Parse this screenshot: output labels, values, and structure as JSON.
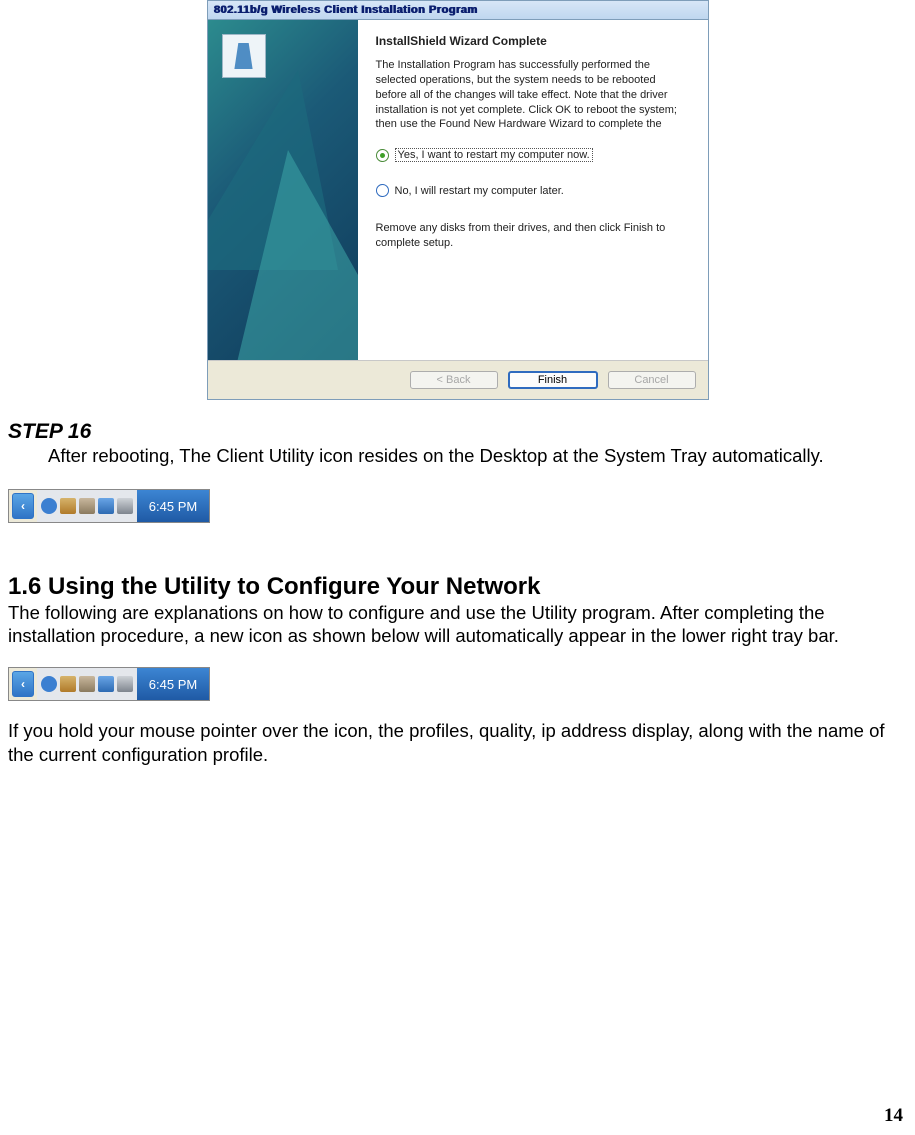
{
  "installer": {
    "title": "802.11b/g Wireless Client Installation Program",
    "heading": "InstallShield Wizard Complete",
    "body": "The Installation Program has successfully performed the selected operations, but the system needs to be rebooted before all of the changes will take effect. Note that the driver installation is not yet complete. Click OK to reboot the system; then use the Found New Hardware Wizard to complete the",
    "radio_yes": "Yes, I want to restart my computer now.",
    "radio_no": "No, I will restart my computer later.",
    "remove_text": "Remove any disks from their drives, and then click Finish to complete setup.",
    "btn_back": "< Back",
    "btn_finish": "Finish",
    "btn_cancel": "Cancel"
  },
  "step": {
    "heading": "STEP 16",
    "body": "After rebooting, The Client Utility icon resides on the Desktop at the System Tray automatically."
  },
  "tray": {
    "chevron": "‹",
    "time": "6:45 PM"
  },
  "section": {
    "heading": "1.6 Using the Utility to Configure Your Network",
    "para1": "The following are explanations on how to configure and use the Utility program. After completing the installation procedure, a new icon as shown below will automatically appear in the lower right tray bar.",
    "para2": "If you hold your mouse pointer over the icon, the profiles, quality, ip address display, along with the name of the current configuration profile."
  },
  "page_number": "14"
}
